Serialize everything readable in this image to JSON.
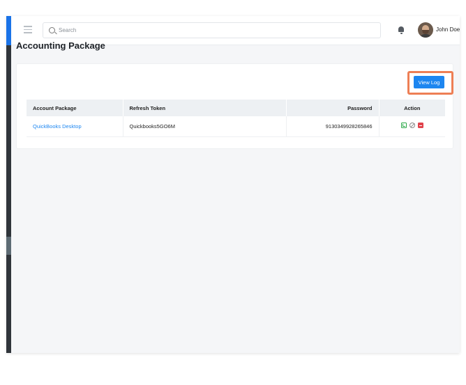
{
  "header": {
    "search_placeholder": "Search",
    "user_name": "John Doe"
  },
  "page": {
    "title": "Accounting Package"
  },
  "toolbar": {
    "view_log_label": "View Log"
  },
  "table": {
    "columns": [
      "Account Package",
      "Refresh Token",
      "Password",
      "Action"
    ],
    "rows": [
      {
        "account_package": "QuickBooks Desktop",
        "refresh_token": "Quickbooks5GO6M",
        "password": "9130349928265846"
      }
    ]
  },
  "colors": {
    "accent": "#1d86f0",
    "highlight": "#ee7f55",
    "sidebar": "#30353b",
    "view_action": "#27a745",
    "delete_action": "#e0424b"
  },
  "icons": [
    "menu-icon",
    "search-icon",
    "bell-icon",
    "avatar",
    "view-icon",
    "edit-icon",
    "delete-icon"
  ]
}
